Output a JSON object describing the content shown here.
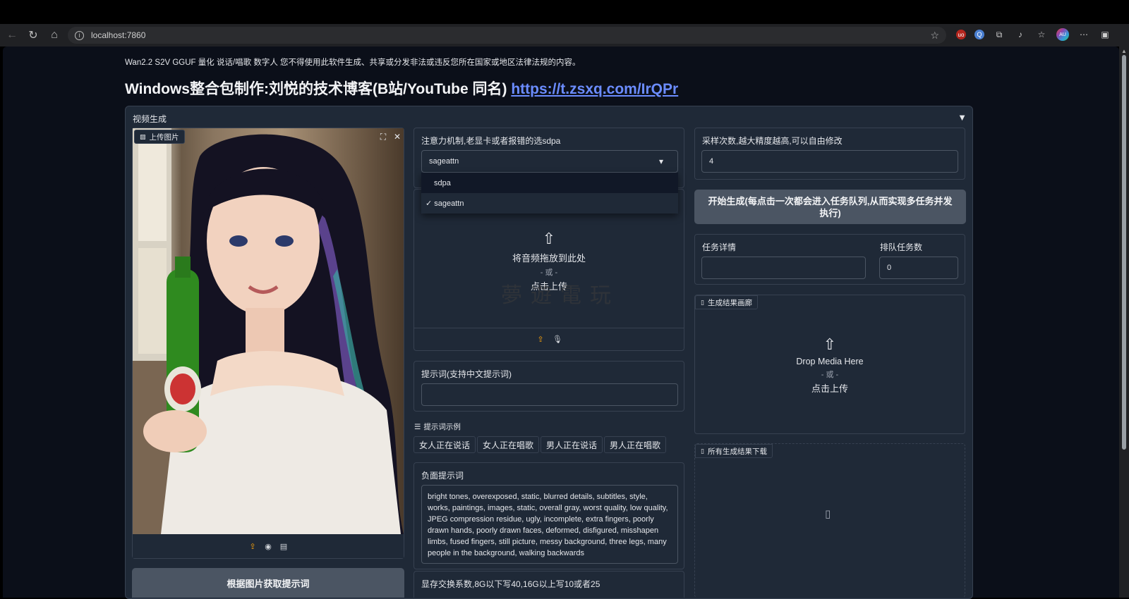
{
  "browser": {
    "url": "localhost:7860",
    "extensions": [
      "ublock-icon",
      "search-ext-icon",
      "puzzle-icon",
      "reading-icon",
      "favorites-icon",
      "profile-icon",
      "more-icon",
      "sidebar-icon"
    ],
    "profile_text": "AU"
  },
  "page": {
    "disclaimer": "Wan2.2 S2V GGUF 量化 说话/唱歌 数字人 您不得使用此软件生成、共享或分发非法或违反您所在国家或地区法律法规的内容。",
    "headline_text": "Windows整合包制作:刘悦的技术博客(B站/YouTube 同名) ",
    "headline_link": "https://t.zsxq.com/IrQPr",
    "accordion_title": "视频生成",
    "accordion_arrow": "▼"
  },
  "image_upload": {
    "label": "上传图片",
    "get_prompt_button": "根据图片获取提示词",
    "fullscreen_icon": "⛶",
    "close_icon": "✕"
  },
  "attention": {
    "label": "注意力机制,老显卡或者报错的选sdpa",
    "selected": "sageattn",
    "options": [
      {
        "label": "sdpa",
        "checked": false
      },
      {
        "label": "✓ sageattn",
        "checked": true
      }
    ],
    "caret": "▾"
  },
  "audio_upload": {
    "drop_text": "将音频拖放到此处",
    "or_text": "- 或 -",
    "click_text": "点击上传",
    "watermark": "夢遊電玩"
  },
  "prompt": {
    "label": "提示词(支持中文提示词)",
    "value": ""
  },
  "examples": {
    "label": "提示词示例",
    "items": [
      "女人正在说话",
      "女人正在唱歌",
      "男人正在说话",
      "男人正在唱歌"
    ]
  },
  "negative": {
    "label": "负面提示词",
    "value": "bright tones, overexposed, static, blurred details, subtitles, style, works, paintings, images, static, overall gray, worst quality, low quality, JPEG compression residue, ugly, incomplete, extra fingers, poorly drawn hands, poorly drawn faces, deformed, disfigured, misshapen limbs, fused fingers, still picture, messy background, three legs, many people in the background, walking backwards"
  },
  "swap": {
    "label": "显存交换系数,8G以下写40,16G以上写10或者25"
  },
  "steps": {
    "label": "采样次数,越大精度越高,可以自由修改",
    "value": "4"
  },
  "generate": {
    "button": "开始生成(每点击一次都会进入任务队列,从而实现多任务并发执行)"
  },
  "task": {
    "detail_label": "任务详情",
    "detail_value": "",
    "queue_label": "排队任务数",
    "queue_value": "0"
  },
  "gallery": {
    "label": "生成结果画廊",
    "drop_text": "Drop Media Here",
    "or_text": "- 或 -",
    "click_text": "点击上传"
  },
  "downloads": {
    "label": "所有生成结果下载"
  },
  "colors": {
    "background": "#0b0f19",
    "panel": "#1f2937",
    "border": "#374151",
    "button": "#4b5563",
    "link": "#6b8cff",
    "accent": "#f59e0b"
  }
}
